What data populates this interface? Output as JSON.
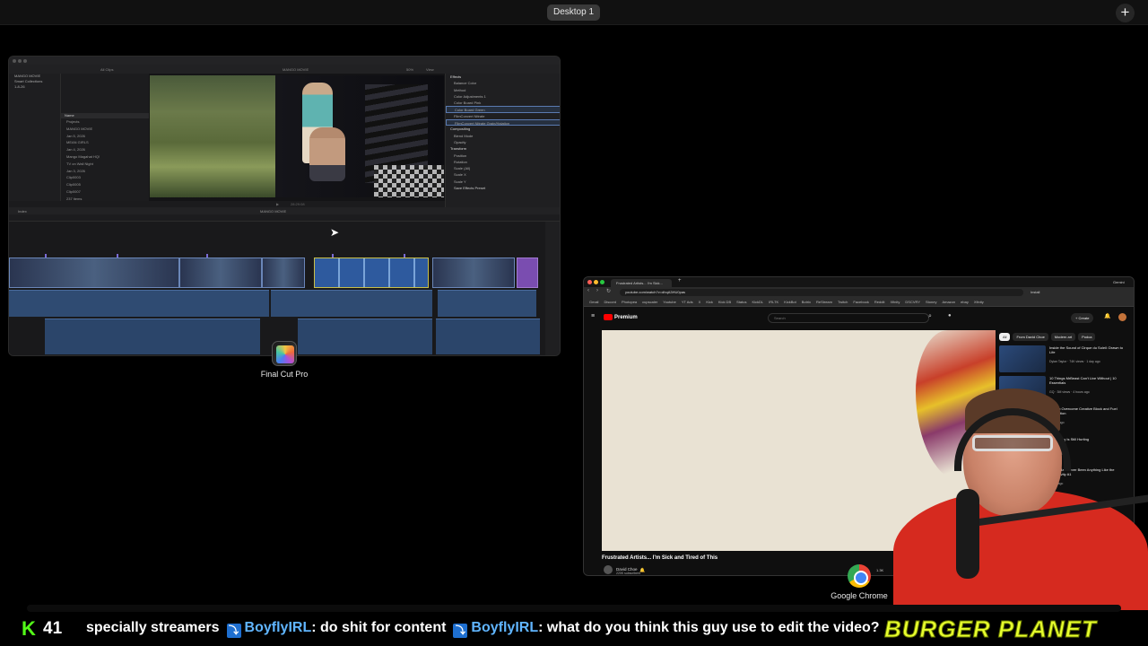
{
  "mission_control": {
    "desktop_label": "Desktop 1",
    "add_label": "+"
  },
  "fcp": {
    "app_label": "Final Cut Pro",
    "toolbar": {
      "filter": "All Clips",
      "project": "MANGO MOVIE",
      "zoom": "50%",
      "view": "View"
    },
    "library": [
      "MANGO MOVIE",
      "Smart Collections",
      "1-8-26"
    ],
    "browser_header": "Name",
    "browser_rows": [
      "Projects",
      "MANGO MOVIE",
      "Jan 5, 2026",
      "MEAN GIRLS",
      "Jan 4, 2026",
      "Mango Magahat HQ!",
      "TV on Wall Night",
      "Jan 3, 2026",
      "Clip0003",
      "Clip0005",
      "Clip0007"
    ],
    "browser_footer": "237 items",
    "timecode": "28:29:08",
    "inspector": [
      {
        "label": "Effects",
        "kind": "h"
      },
      {
        "label": "Balance Color",
        "kind": ""
      },
      {
        "label": "Method",
        "kind": ""
      },
      {
        "label": "Color Adjustments 1",
        "kind": ""
      },
      {
        "label": "Color Board Pink",
        "kind": ""
      },
      {
        "label": "Color Board Green",
        "kind": "sel"
      },
      {
        "label": "FilmConvert Nitrate",
        "kind": ""
      },
      {
        "label": "FilmConvert Nitrate Grain/Halation",
        "kind": "sel"
      },
      {
        "label": "Compositing",
        "kind": "h"
      },
      {
        "label": "Blend Mode",
        "kind": ""
      },
      {
        "label": "Opacity",
        "kind": ""
      },
      {
        "label": "Transform",
        "kind": "h"
      },
      {
        "label": "Position",
        "kind": ""
      },
      {
        "label": "Rotation",
        "kind": ""
      },
      {
        "label": "Scale (All)",
        "kind": ""
      },
      {
        "label": "Scale X",
        "kind": ""
      },
      {
        "label": "Scale Y",
        "kind": ""
      }
    ],
    "inspector_footer": "Save Effects Preset",
    "timeline": {
      "index_label": "Index",
      "project": "MANGO MOVIE"
    }
  },
  "chrome": {
    "app_label": "Google Chrome",
    "tab_title": "Frustrated Artists... I'm Sick...",
    "url": "youtube.com/watch?v=dhqA3HU0pas",
    "bookmarks": [
      "Gmail",
      "Discord",
      "Photopea",
      "cupscaler",
      "Youtube",
      "YT Ads",
      "X",
      "Kick",
      "Kick DB",
      "Status",
      "KickDL",
      "IRLTK",
      "KickBot",
      "Botrix",
      "ReStream",
      "Twitch",
      "Facebook",
      "Reddit",
      "Xfinity",
      "DSCVRY",
      "Stoney",
      "Amazon",
      "ebay",
      "Xfinity"
    ],
    "gemini": "Gemini",
    "install": "Install"
  },
  "youtube": {
    "logo_text": "Premium",
    "search_placeholder": "Search",
    "create_label": "+ Create",
    "video_title": "Frustrated Artists... I'm Sick and Tired of This",
    "channel": "David Choe",
    "subscribers": "220K subscribers",
    "likes": "1.3K",
    "chips": [
      "All",
      "From David Choe",
      "Modern art",
      "Podca"
    ],
    "recommendations": [
      {
        "title": "Inside the Sound of Cirque du Soleil: Drawn to Life",
        "meta": "Dylan Taylor · 74K views · 1 day ago"
      },
      {
        "title": "10 Things MrBeast Can't Live Without | 10 Essentials",
        "meta": "GQ · 3M views · 4 hours ago"
      },
      {
        "title": "How to Overcome Creative Block and Fuel Inspiration",
        "meta": "1 year ago"
      },
      {
        "title": "Illustrating Is Still Hurting",
        "meta": "3 days ago"
      },
      {
        "title": "There Has Never Been Anything Like the Antigravity A1",
        "meta": "1 day ago"
      }
    ]
  },
  "ticker": {
    "platform_letter": "K",
    "viewer_count": "41",
    "fragment": "specially streamers",
    "messages": [
      {
        "user": "BoyflyIRL",
        "text": ": do shit for content"
      },
      {
        "user": "BoyflyIRL",
        "text": ": what do you think this guy use to edit the video?"
      }
    ],
    "brand": "BURGER PLANET"
  }
}
